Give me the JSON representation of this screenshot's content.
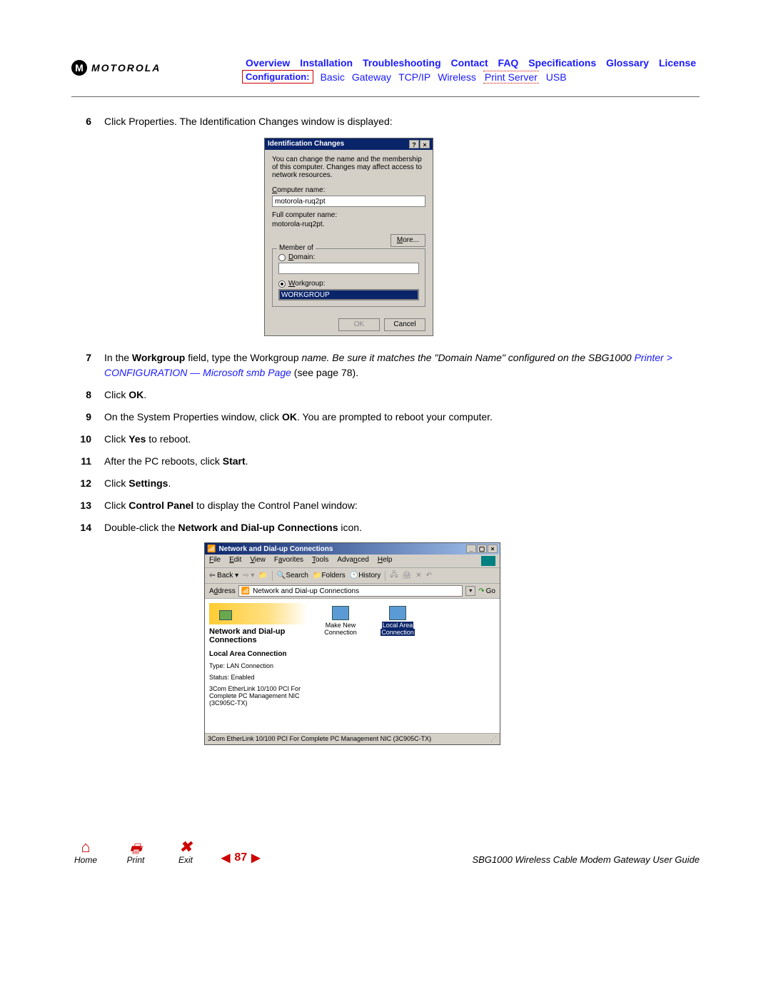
{
  "logo": {
    "glyph": "M",
    "text": "MOTOROLA"
  },
  "nav": {
    "row1": [
      "Overview",
      "Installation",
      "Troubleshooting",
      "Contact",
      "FAQ",
      "Specifications",
      "Glossary",
      "License"
    ],
    "config_label": "Configuration:",
    "row2": [
      "Basic",
      "Gateway",
      "TCP/IP",
      "Wireless",
      "Print Server",
      "USB"
    ]
  },
  "steps": {
    "s6": {
      "num": "6",
      "text": "Click Properties. The Identification Changes window is displayed:"
    },
    "s7": {
      "num": "7",
      "pre": "In the ",
      "b1": "Workgroup",
      "mid": " field, type the Workgroup ",
      "i1": "name. Be sure it matches the \"Domain Name\" configured on the SBG1000 ",
      "link": "Printer > CONFIGURATION — Microsoft smb Page",
      "post": " (see page 78)."
    },
    "s8": {
      "num": "8",
      "pre": "Click ",
      "b": "OK",
      "post": "."
    },
    "s9": {
      "num": "9",
      "pre": "On the System Properties window, click ",
      "b": "OK",
      "post": ". You are prompted to reboot your computer."
    },
    "s10": {
      "num": "10",
      "pre": "Click ",
      "b": "Yes",
      "post": " to reboot."
    },
    "s11": {
      "num": "11",
      "pre": "After the PC reboots, click ",
      "b": "Start",
      "post": "."
    },
    "s12": {
      "num": "12",
      "pre": "Click ",
      "b": "Settings",
      "post": "."
    },
    "s13": {
      "num": "13",
      "pre": "Click ",
      "b": "Control Panel",
      "post": " to display the Control Panel window:"
    },
    "s14": {
      "num": "14",
      "pre": "Double-click the ",
      "b": "Network and Dial-up Connections",
      "post": " icon."
    }
  },
  "dialog1": {
    "title": "Identification Changes",
    "help_icon": "?",
    "close_icon": "×",
    "intro": "You can change the name and the membership of this computer. Changes may affect access to network resources.",
    "cn_label": "Computer name:",
    "cn_value": "motorola-ruq2pt",
    "fcn_label": "Full computer name:",
    "fcn_value": "motorola-ruq2pt.",
    "more": "More...",
    "member_legend": "Member of",
    "domain_label": "Domain:",
    "workgroup_label": "Workgroup:",
    "workgroup_value": "WORKGROUP",
    "ok": "OK",
    "cancel": "Cancel"
  },
  "dialog2": {
    "title": "Network and Dial-up Connections",
    "menu": {
      "file": "File",
      "edit": "Edit",
      "view": "View",
      "fav": "Favorites",
      "tools": "Tools",
      "adv": "Advanced",
      "help": "Help"
    },
    "tb": {
      "back": "Back",
      "search": "Search",
      "folders": "Folders",
      "history": "History"
    },
    "addr_label": "Address",
    "addr_value": "Network and Dial-up Connections",
    "go": "Go",
    "left_title": "Network and Dial-up Connections",
    "sub_title": "Local Area Connection",
    "type_line": "Type: LAN Connection",
    "status_line": "Status: Enabled",
    "nic_line": "3Com EtherLink 10/100 PCI For Complete PC Management NIC (3C905C-TX)",
    "icon1_l1": "Make New",
    "icon1_l2": "Connection",
    "icon2_l1": "Local Area",
    "icon2_l2": "Connection",
    "status": "3Com EtherLink 10/100 PCI For Complete PC Management NIC (3C905C-TX)"
  },
  "footer": {
    "home": "Home",
    "print": "Print",
    "exit": "Exit",
    "page": "87",
    "guide": "SBG1000 Wireless Cable Modem Gateway User Guide"
  }
}
